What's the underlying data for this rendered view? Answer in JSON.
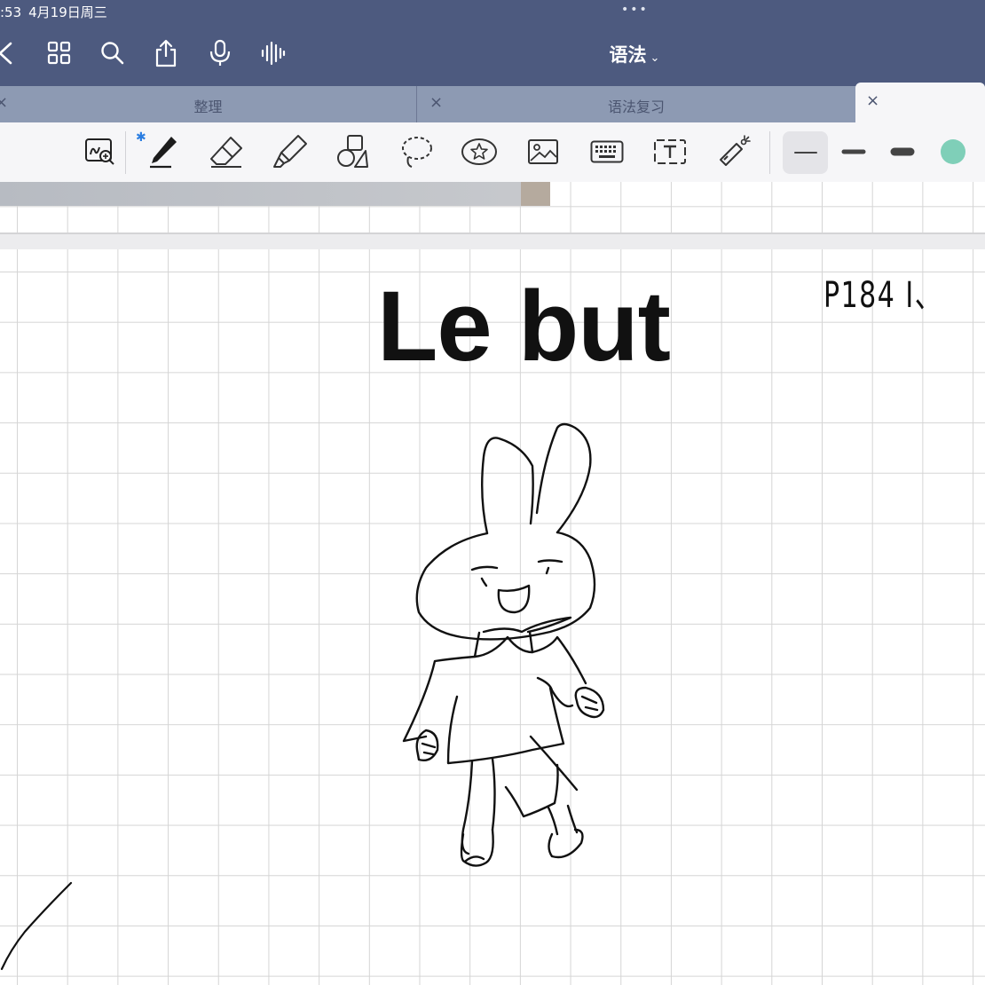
{
  "status_bar": {
    "time": ":53",
    "date": "4月19日周三",
    "dots": "•••"
  },
  "nav": {
    "title": "语法",
    "icons": [
      "back-icon",
      "grid-icon",
      "search-icon",
      "share-icon",
      "microphone-icon",
      "audio-wave-icon"
    ]
  },
  "tabs": [
    {
      "label": "整理",
      "close": ""
    },
    {
      "label": "语法复习",
      "close": "×"
    },
    {
      "label": "",
      "close": "×",
      "active": true
    }
  ],
  "toolbar": {
    "bluetooth": "✱",
    "tools": [
      "zoom-window-icon",
      "pen-icon",
      "eraser-icon",
      "highlighter-icon",
      "shapes-icon",
      "lasso-icon",
      "sticker-icon",
      "image-icon",
      "keyboard-icon",
      "text-box-icon",
      "laser-pointer-icon"
    ],
    "stroke_widths": [
      "thin",
      "medium",
      "thick"
    ],
    "selected_width": "thin",
    "current_color": "#7fcfb8"
  },
  "page": {
    "heading": "Le but",
    "handwritten_note": "P184 I、"
  }
}
